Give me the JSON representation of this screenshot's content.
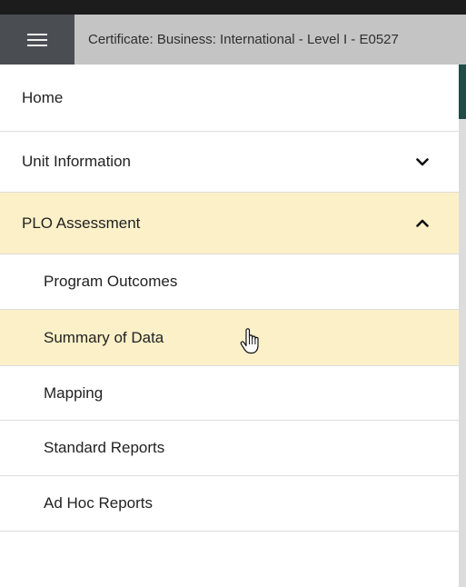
{
  "header": {
    "title": "Certificate: Business: International - Level I - E0527"
  },
  "nav": {
    "items": [
      {
        "label": "Home",
        "level": "top"
      },
      {
        "label": "Unit Information",
        "level": "top",
        "expandable": true,
        "expanded": false
      },
      {
        "label": "PLO Assessment",
        "level": "top",
        "expandable": true,
        "expanded": true,
        "active": true
      },
      {
        "label": "Program Outcomes",
        "level": "sub"
      },
      {
        "label": "Summary of Data",
        "level": "sub",
        "active": true
      },
      {
        "label": "Mapping",
        "level": "sub"
      },
      {
        "label": "Standard Reports",
        "level": "sub"
      },
      {
        "label": "Ad Hoc Reports",
        "level": "sub"
      }
    ]
  },
  "icons": {
    "menu": "hamburger-menu-icon",
    "collapsed": "chevron-down-icon",
    "expanded": "chevron-up-icon",
    "pointer": "hand-pointer-cursor-icon"
  },
  "colors": {
    "header_bg": "#c4c4c4",
    "menu_button_bg": "#4a4e53",
    "active_bg": "#fcf0c8",
    "divider": "#dcdcdc",
    "accent": "#1f4d45"
  }
}
